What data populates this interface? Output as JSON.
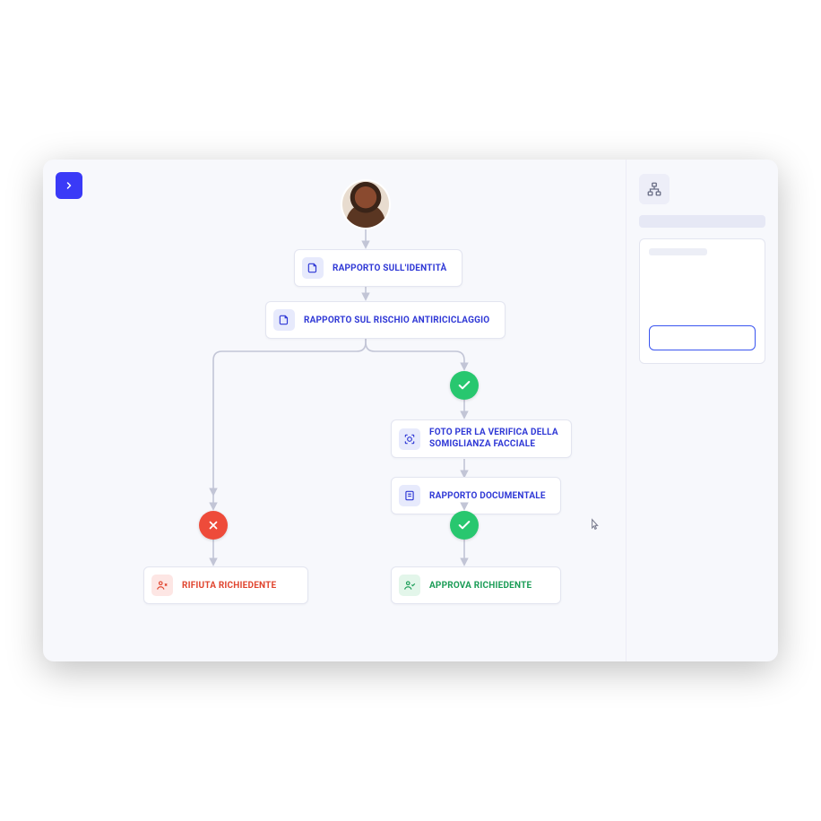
{
  "nodes": {
    "identity": {
      "label": "RAPPORTO SULL'IDENTITÀ"
    },
    "aml": {
      "label": "RAPPORTO SUL RISCHIO ANTIRICICLAGGIO"
    },
    "face": {
      "label": "FOTO PER LA VERIFICA DELLA SOMIGLIANZA FACCIALE"
    },
    "docreport": {
      "label": "RAPPORTO DOCUMENTALE"
    },
    "reject": {
      "label": "RIFIUTA RICHIEDENTE"
    },
    "approve": {
      "label": "APPROVA RICHIEDENTE"
    }
  },
  "colors": {
    "indigo": "#2f38d6",
    "red": "#e0452f",
    "green": "#1a9c56",
    "accent": "#3a3af7"
  }
}
